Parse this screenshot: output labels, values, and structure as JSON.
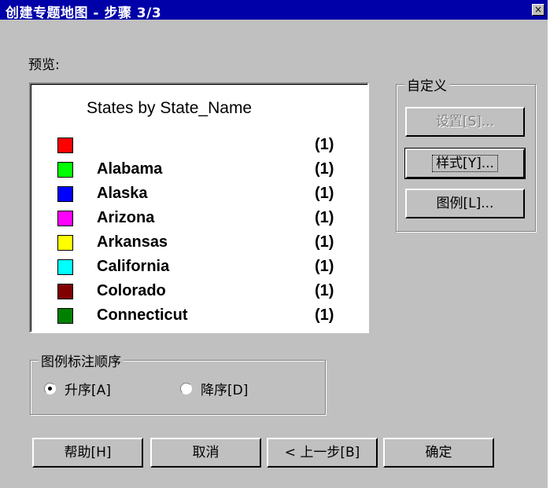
{
  "window": {
    "title": "创建专题地图 - 步骤 3/3",
    "close_symbol": "×"
  },
  "preview": {
    "label": "预览:",
    "legend_title": "States by State_Name",
    "items": [
      {
        "name": "",
        "count": "(1)",
        "color": "#ff0000"
      },
      {
        "name": "Alabama",
        "count": "(1)",
        "color": "#00ff00"
      },
      {
        "name": "Alaska",
        "count": "(1)",
        "color": "#0000ff"
      },
      {
        "name": "Arizona",
        "count": "(1)",
        "color": "#ff00ff"
      },
      {
        "name": "Arkansas",
        "count": "(1)",
        "color": "#ffff00"
      },
      {
        "name": "California",
        "count": "(1)",
        "color": "#00ffff"
      },
      {
        "name": "Colorado",
        "count": "(1)",
        "color": "#800000"
      },
      {
        "name": "Connecticut",
        "count": "(1)",
        "color": "#008000"
      }
    ]
  },
  "customize": {
    "label": "自定义",
    "settings_button": "设置[S]...",
    "style_button": "样式[Y]...",
    "legend_button": "图例[L]..."
  },
  "order": {
    "label": "图例标注顺序",
    "ascending": "升序[A]",
    "descending": "降序[D]",
    "selected": "ascending"
  },
  "footer": {
    "help": "帮助[H]",
    "cancel": "取消",
    "back": "< 上一步[B]",
    "ok": "确定"
  }
}
